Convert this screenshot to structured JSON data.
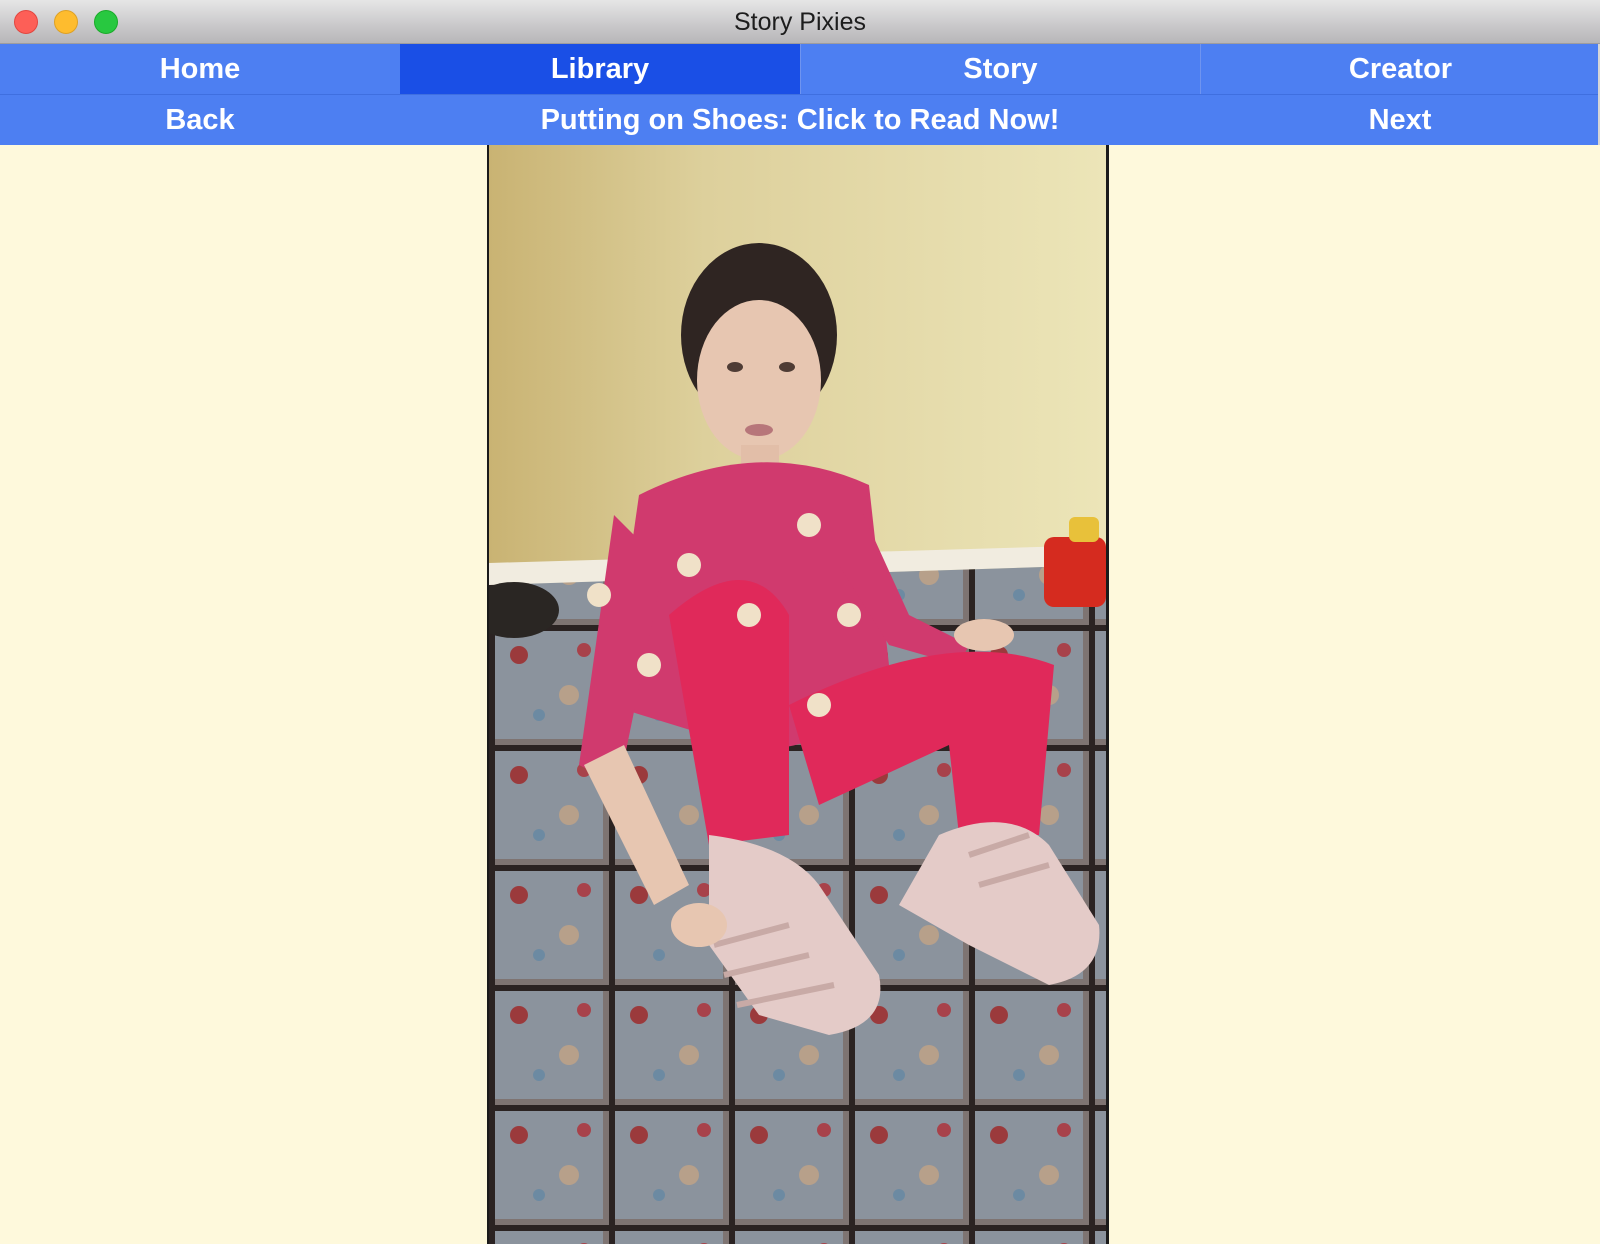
{
  "window": {
    "title": "Story Pixies"
  },
  "nav": {
    "items": [
      {
        "label": "Home",
        "active": false
      },
      {
        "label": "Library",
        "active": true
      },
      {
        "label": "Story",
        "active": false
      },
      {
        "label": "Creator",
        "active": false
      }
    ]
  },
  "pager": {
    "back_label": "Back",
    "title_label": "Putting on Shoes: Click to Read Now!",
    "next_label": "Next"
  },
  "colors": {
    "nav_bg": "#4d7ff2",
    "nav_active": "#1a4fe6",
    "content_bg": "#fef9dc"
  }
}
